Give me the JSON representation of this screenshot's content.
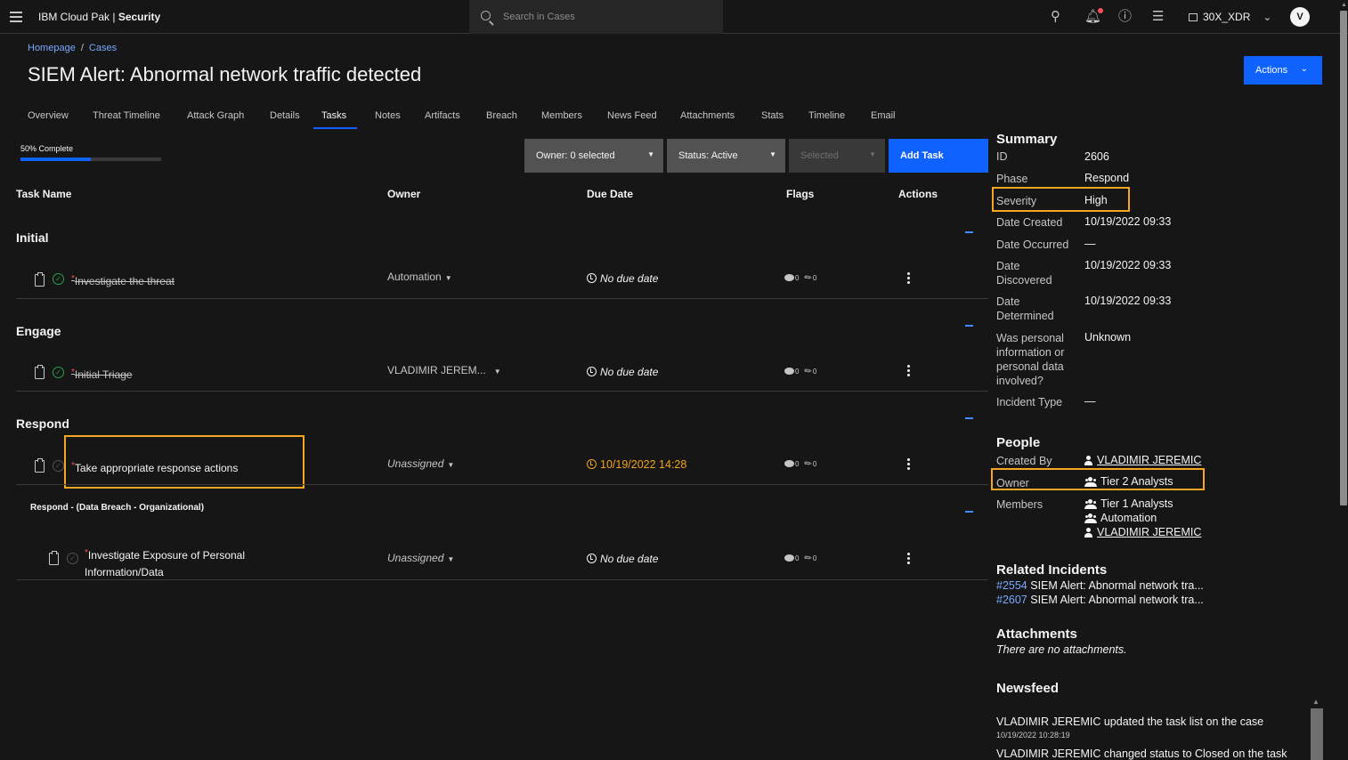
{
  "header": {
    "brand_regular": "IBM Cloud Pak | ",
    "brand_bold": "Security",
    "search_placeholder": "Search in Cases",
    "account": "30X_XDR",
    "avatar_initial": "V"
  },
  "breadcrumb": {
    "home": "Homepage",
    "sep": "/",
    "current": "Cases"
  },
  "page_title": "SIEM Alert: Abnormal network traffic detected",
  "actions_label": "Actions",
  "tabs": [
    "Overview",
    "Threat Timeline",
    "Attack Graph",
    "Details",
    "Tasks",
    "Notes",
    "Artifacts",
    "Breach",
    "Members",
    "News Feed",
    "Attachments",
    "Stats",
    "Timeline",
    "Email"
  ],
  "active_tab": "Tasks",
  "progress": {
    "label": "50% Complete",
    "fraction": 0.5
  },
  "filters": {
    "owner": "Owner: 0 selected",
    "status": "Status: Active",
    "selected": "Selected",
    "add_task": "Add Task"
  },
  "table_headers": {
    "task_name": "Task Name",
    "owner": "Owner",
    "due_date": "Due Date",
    "flags": "Flags",
    "actions": "Actions"
  },
  "groups": [
    {
      "name": "Initial"
    },
    {
      "name": "Engage"
    },
    {
      "name": "Respond"
    },
    {
      "name": "Respond - (Data Breach - Organizational)"
    }
  ],
  "tasks": [
    {
      "name": "Investigate the threat",
      "owner": "Automation",
      "due": "No due date",
      "notes": "0",
      "attachments": "0",
      "completed": true
    },
    {
      "name": "Initial Triage",
      "owner": "VLADIMIR JEREM...",
      "due": "No due date",
      "notes": "0",
      "attachments": "0",
      "completed": true
    },
    {
      "name": "Take appropriate response actions",
      "owner": "Unassigned",
      "due": "10/19/2022 14:28",
      "notes": "0",
      "attachments": "0",
      "completed": false
    },
    {
      "name_line1": "Investigate Exposure of Personal",
      "name_line2": "Information/Data",
      "owner": "Unassigned",
      "due": "No due date",
      "notes": "0",
      "attachments": "0",
      "completed": false
    }
  ],
  "required_mark": "*",
  "summary": {
    "heading": "Summary",
    "id_label": "ID",
    "id": "2606",
    "phase_label": "Phase",
    "phase": "Respond",
    "severity_label": "Severity",
    "severity": "High",
    "created_label": "Date Created",
    "created": "10/19/2022 09:33",
    "occurred_label": "Date Occurred",
    "occurred": "—",
    "discovered_label": "Date Discovered",
    "discovered": "10/19/2022 09:33",
    "determined_label": "Date Determined",
    "determined": "10/19/2022 09:33",
    "personal_label": "Was personal information or personal data involved?",
    "personal": "Unknown",
    "incident_type_label": "Incident Type",
    "incident_type": "—"
  },
  "people": {
    "heading": "People",
    "created_by_label": "Created By",
    "created_by": "VLADIMIR JEREMIC",
    "owner_label": "Owner",
    "owner": "Tier 2 Analysts",
    "members_label": "Members",
    "members": [
      "Tier 1 Analysts",
      "Automation",
      "VLADIMIR JEREMIC"
    ]
  },
  "related": {
    "heading": "Related Incidents",
    "items": [
      {
        "id": "#2554",
        "title": "SIEM Alert: Abnormal network tra..."
      },
      {
        "id": "#2607",
        "title": "SIEM Alert: Abnormal network tra..."
      }
    ]
  },
  "attachments": {
    "heading": "Attachments",
    "empty": "There are no attachments."
  },
  "newsfeed": {
    "heading": "Newsfeed",
    "items": [
      {
        "text": "VLADIMIR JEREMIC updated the task list on the case",
        "time": "10/19/2022 10:28:19"
      },
      {
        "text": "VLADIMIR JEREMIC changed status to Closed on the task",
        "time": ""
      }
    ]
  },
  "colors": {
    "accent": "#0f62fe",
    "highlight": "#f5a623",
    "done": "#24a148",
    "overdue": "#f1a41b"
  }
}
